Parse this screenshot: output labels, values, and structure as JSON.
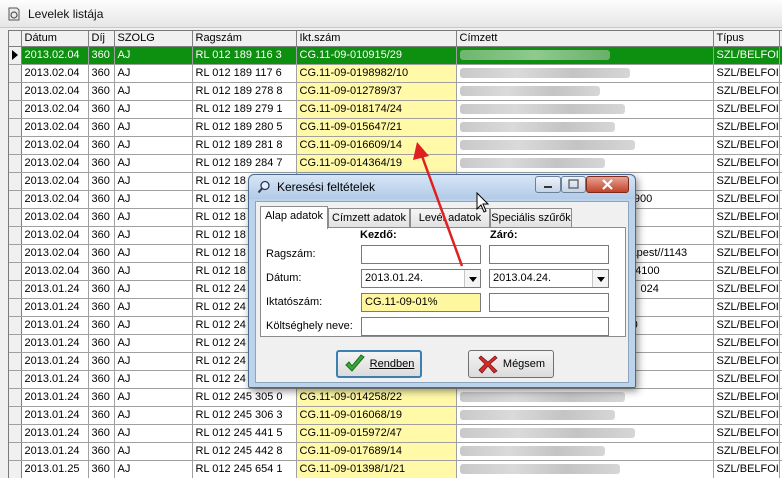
{
  "window": {
    "title": "Levelek listája"
  },
  "columns": [
    "Dátum",
    "Díj",
    "SZOLG",
    "Ragszám",
    "Ikt.szám",
    "Címzett",
    "Típus"
  ],
  "rows": [
    {
      "datum": "2013.02.04",
      "dij": "360",
      "szolg": "AJ",
      "ragszam": "RL  012 189 116 3",
      "ikt": "CG.11-09-010915/29",
      "cimzett": "",
      "tipus": "SZL/BELFOI"
    },
    {
      "datum": "2013.02.04",
      "dij": "360",
      "szolg": "AJ",
      "ragszam": "RL  012 189 117 6",
      "ikt": "CG.11-09-0198982/10",
      "cimzett": "",
      "tipus": "SZL/BELFOI"
    },
    {
      "datum": "2013.02.04",
      "dij": "360",
      "szolg": "AJ",
      "ragszam": "RL  012 189 278 8",
      "ikt": "CG.11-09-012789/37",
      "cimzett": "",
      "tipus": "SZL/BELFOI"
    },
    {
      "datum": "2013.02.04",
      "dij": "360",
      "szolg": "AJ",
      "ragszam": "RL  012 189 279 1",
      "ikt": "CG.11-09-018174/24",
      "cimzett": "",
      "tipus": "SZL/BELFOI"
    },
    {
      "datum": "2013.02.04",
      "dij": "360",
      "szolg": "AJ",
      "ragszam": "RL  012 189 280 5",
      "ikt": "CG.11-09-015647/21",
      "cimzett": "",
      "tipus": "SZL/BELFOI"
    },
    {
      "datum": "2013.02.04",
      "dij": "360",
      "szolg": "AJ",
      "ragszam": "RL  012 189 281 8",
      "ikt": "CG.11-09-016609/14",
      "cimzett": "",
      "tipus": "SZL/BELFOI"
    },
    {
      "datum": "2013.02.04",
      "dij": "360",
      "szolg": "AJ",
      "ragszam": "RL  012 189 284 7",
      "ikt": "CG.11-09-014364/19",
      "cimzett": "",
      "tipus": "SZL/BELFOI"
    },
    {
      "datum": "2013.02.04",
      "dij": "360",
      "szolg": "AJ",
      "ragszam": "RL  012 18",
      "ikt": "",
      "cimzett": "",
      "tipus": "SZL/BELFOI"
    },
    {
      "datum": "2013.02.04",
      "dij": "360",
      "szolg": "AJ",
      "ragszam": "RL  012 18",
      "ikt": "",
      "cimzett": "g//8900",
      "tipus": "SZL/BELFOI"
    },
    {
      "datum": "2013.02.04",
      "dij": "360",
      "szolg": "AJ",
      "ragszam": "RL  012 18",
      "ikt": "",
      "cimzett": "",
      "tipus": "SZL/BELFOI"
    },
    {
      "datum": "2013.02.04",
      "dij": "360",
      "szolg": "AJ",
      "ragszam": "RL  012 18",
      "ikt": "",
      "cimzett": "",
      "tipus": "SZL/BELFOI"
    },
    {
      "datum": "2013.02.04",
      "dij": "360",
      "szolg": "AJ",
      "ragszam": "RL  012 18",
      "ikt": "",
      "cimzett": "apest//1143",
      "tipus": "SZL/BELFOI"
    },
    {
      "datum": "2013.02.04",
      "dij": "360",
      "szolg": "AJ",
      "ragszam": "RL  012 18",
      "ikt": "",
      "cimzett": "lu//4100",
      "tipus": "SZL/BELFOI"
    },
    {
      "datum": "2013.01.24",
      "dij": "360",
      "szolg": "AJ",
      "ragszam": "RL  012 24",
      "ikt": "",
      "cimzett": "024",
      "tipus": "SZL/BELFOI"
    },
    {
      "datum": "2013.01.24",
      "dij": "360",
      "szolg": "AJ",
      "ragszam": "RL  012 24",
      "ikt": "",
      "cimzett": "",
      "tipus": "SZL/BELFOI"
    },
    {
      "datum": "2013.01.24",
      "dij": "360",
      "szolg": "AJ",
      "ragszam": "RL  012 24",
      "ikt": "",
      "cimzett": "00",
      "tipus": "SZL/BELFOI"
    },
    {
      "datum": "2013.01.24",
      "dij": "360",
      "szolg": "AJ",
      "ragszam": "RL  012 24",
      "ikt": "",
      "cimzett": "",
      "tipus": "SZL/BELFOI"
    },
    {
      "datum": "2013.01.24",
      "dij": "360",
      "szolg": "AJ",
      "ragszam": "RL  012 24",
      "ikt": "",
      "cimzett": "",
      "tipus": "SZL/BELFOI"
    },
    {
      "datum": "2013.01.24",
      "dij": "360",
      "szolg": "AJ",
      "ragszam": "RL  012 24",
      "ikt": "",
      "cimzett": "",
      "tipus": "SZL/BELFOI"
    },
    {
      "datum": "2013.01.24",
      "dij": "360",
      "szolg": "AJ",
      "ragszam": "RL  012 245 305 0",
      "ikt": "CG.11-09-014258/22",
      "cimzett": "",
      "tipus": "SZL/BELFOI"
    },
    {
      "datum": "2013.01.24",
      "dij": "360",
      "szolg": "AJ",
      "ragszam": "RL  012 245 306 3",
      "ikt": "CG.11-09-016068/19",
      "cimzett": "",
      "tipus": "SZL/BELFOI"
    },
    {
      "datum": "2013.01.24",
      "dij": "360",
      "szolg": "AJ",
      "ragszam": "RL  012 245 441 5",
      "ikt": "CG.11-09-015972/47",
      "cimzett": "",
      "tipus": "SZL/BELFOI"
    },
    {
      "datum": "2013.01.24",
      "dij": "360",
      "szolg": "AJ",
      "ragszam": "RL  012 245 442 8",
      "ikt": "CG.11-09-017689/14",
      "cimzett": "",
      "tipus": "SZL/BELFOI"
    },
    {
      "datum": "2013.01.25",
      "dij": "360",
      "szolg": "AJ",
      "ragszam": "RL  012 245 654 1",
      "ikt": "CG.11-09-01398/1/21",
      "cimzett": "",
      "tipus": "SZL/BELFOI"
    }
  ],
  "dialog": {
    "title": "Keresési feltételek",
    "tabs": [
      "Alap adatok",
      "Címzett adatok",
      "Levél adatok",
      "Speciális szűrők"
    ],
    "col_start": "Kezdő:",
    "col_end": "Záró:",
    "labels": {
      "ragszam": "Ragszám:",
      "datum": "Dátum:",
      "iktatoszam": "Iktatószám:",
      "koltseghely": "Költséghely neve:"
    },
    "values": {
      "ragszam_start": "",
      "ragszam_end": "",
      "datum_start": "2013.01.24.",
      "datum_end": "2013.04.24.",
      "ikt_start": "CG.11-09-01%",
      "ikt_end": "",
      "koltseghely": ""
    },
    "ok_label": "Rendben",
    "cancel_label": "Mégsem"
  },
  "colors": {
    "selected_row": "#0d8f0f",
    "ikt_column": "#fff9a8",
    "arrow": "#e02020"
  }
}
